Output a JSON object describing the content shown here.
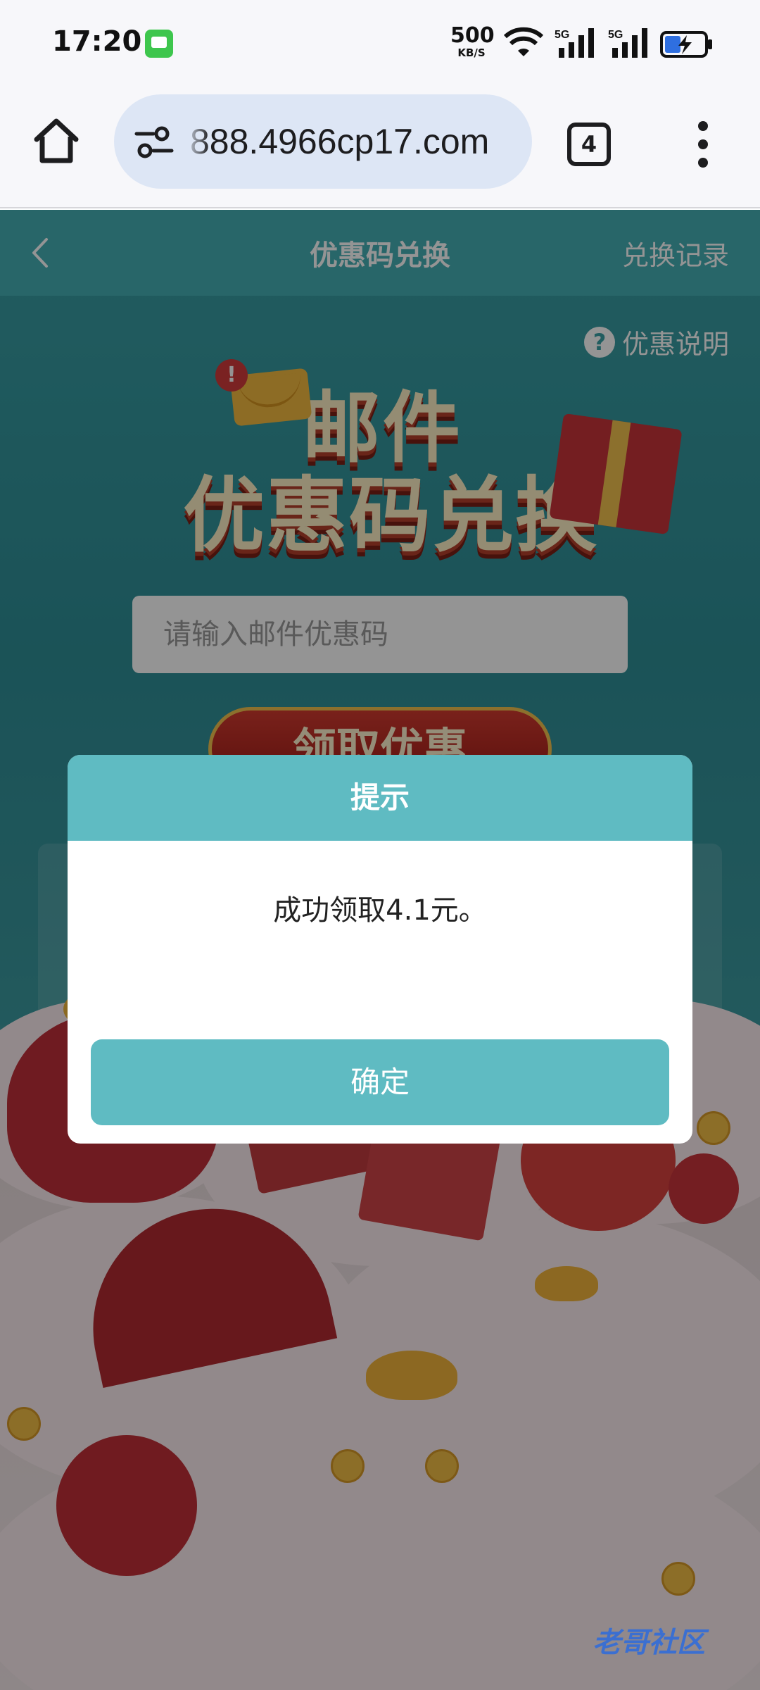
{
  "status_bar": {
    "time": "17:20",
    "net_speed_value": "500",
    "net_speed_unit": "KB/S",
    "signal_1_label": "5G",
    "signal_2_label": "5G",
    "icons": [
      "message-app-icon",
      "wifi-icon",
      "signal-icon",
      "battery-charging-icon"
    ]
  },
  "browser": {
    "url": "888.4966cp17.com",
    "tab_count": "4",
    "icons": [
      "home-icon",
      "site-settings-icon",
      "tabs-icon",
      "more-vert-icon"
    ]
  },
  "page": {
    "title": "优惠码兑换",
    "history_link": "兑换记录",
    "help_label": "优惠说明",
    "help_icon_glyph": "?",
    "hero_line1": "邮件",
    "hero_line2": "优惠码兑换",
    "alert_glyph": "!",
    "code_input_placeholder": "请输入邮件优惠码",
    "claim_button_label": "领取优惠",
    "accent_color": "#46b0b6"
  },
  "dialog": {
    "title": "提示",
    "message": "成功领取4.1元。",
    "confirm_label": "确定",
    "accent_color": "#5fbbc2"
  },
  "watermark": {
    "text": "老哥社区"
  }
}
